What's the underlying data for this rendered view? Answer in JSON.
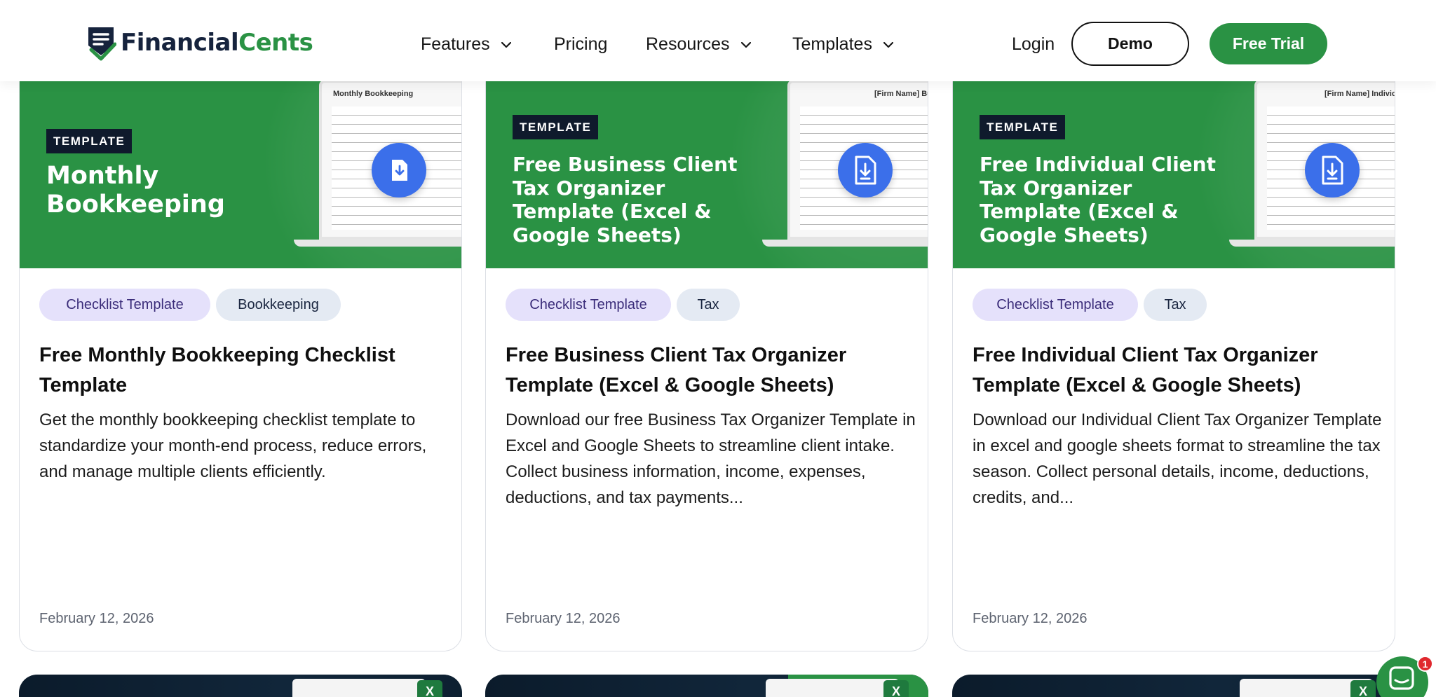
{
  "brand": {
    "name_part1": "Financial",
    "name_part2": "Cents",
    "color_dark": "#16233d",
    "color_green": "#2a9244"
  },
  "nav": {
    "features": "Features",
    "pricing": "Pricing",
    "resources": "Resources",
    "templates": "Templates",
    "login": "Login",
    "demo": "Demo",
    "free_trial": "Free Trial"
  },
  "cards": [
    {
      "banner_tag": "TEMPLATE",
      "banner_title_lines": [
        "Monthly",
        "Bookkeeping"
      ],
      "sheet_heading": "Monthly Bookkeeping",
      "tags": [
        "Checklist Template",
        "Bookkeeping"
      ],
      "title": "Free Monthly Bookkeeping Checklist Template",
      "description": "Get the monthly bookkeeping checklist template to standardize your month-end process, reduce errors, and manage multiple clients efficiently.",
      "date": "February 12, 2026",
      "icon": "download-file-icon"
    },
    {
      "banner_tag": "TEMPLATE",
      "banner_title_lines": [
        "Free Business Client",
        "Tax Organizer",
        "Template (Excel &",
        "Google Sheets)"
      ],
      "sheet_heading": "[Firm Name] Business",
      "tags": [
        "Checklist Template",
        "Tax"
      ],
      "title": "Free Business Client Tax Organizer Template (Excel & Google Sheets)",
      "description": "Download our free Business Tax Organizer Template in Excel and Google Sheets to streamline client intake. Collect business information, income, expenses, deductions, and tax payments...",
      "date": "February 12, 2026",
      "icon": "download-file-icon"
    },
    {
      "banner_tag": "TEMPLATE",
      "banner_title_lines": [
        "Free Individual Client",
        "Tax Organizer",
        "Template (Excel &",
        "Google Sheets)"
      ],
      "sheet_heading": "[Firm Name] Individual Client",
      "tags": [
        "Checklist Template",
        "Tax"
      ],
      "title": "Free Individual Client Tax Organizer Template (Excel & Google Sheets)",
      "description": "Download our Individual Client Tax Organizer Template in excel and google sheets format to streamline the tax season. Collect personal details, income, deductions, credits, and...",
      "date": "February 12, 2026",
      "icon": "download-file-icon"
    }
  ],
  "next_row": {
    "excel_glyph": "X"
  },
  "chat": {
    "badge_count": "1",
    "icon": "chat-bubble-icon"
  }
}
